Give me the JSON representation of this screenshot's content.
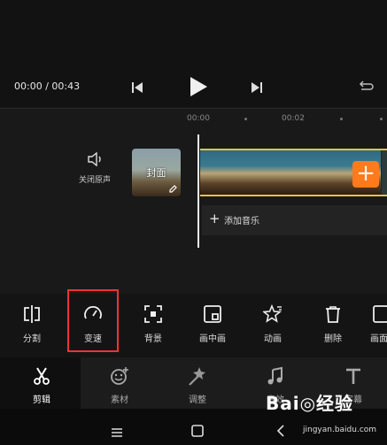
{
  "player": {
    "time_current": "00:00",
    "time_separator": " / ",
    "time_total": "00:43"
  },
  "timeline": {
    "ticks": [
      "00:00",
      "00:02"
    ],
    "mute_label": "关闭原声",
    "cover_label": "封面",
    "add_music_label": "添加音乐",
    "add_clip_symbol": "+",
    "add_music_symbol": "+"
  },
  "tools": [
    {
      "label": "分割",
      "icon": "split-icon"
    },
    {
      "label": "变速",
      "icon": "speed-icon",
      "highlighted": true
    },
    {
      "label": "背景",
      "icon": "background-icon"
    },
    {
      "label": "画中画",
      "icon": "picture-in-picture-icon"
    },
    {
      "label": "动画",
      "icon": "animation-star-icon"
    },
    {
      "label": "删除",
      "icon": "trash-icon"
    },
    {
      "label": "画面",
      "icon": "frame-icon"
    }
  ],
  "tabs": [
    {
      "label": "剪辑",
      "icon": "scissors-icon",
      "active": true
    },
    {
      "label": "素材",
      "icon": "smiley-plus-icon"
    },
    {
      "label": "调整",
      "icon": "magic-wand-icon"
    },
    {
      "label": "音效",
      "icon": "music-note-icon"
    },
    {
      "label": "字幕",
      "icon": "text-icon"
    }
  ],
  "watermark": {
    "text": "Bai◎经验",
    "url": "jingyan.baidu.com"
  },
  "colors": {
    "accent_orange": "#ff7a1a",
    "clip_border": "#e8c441",
    "highlight_box": "#ee3333"
  }
}
